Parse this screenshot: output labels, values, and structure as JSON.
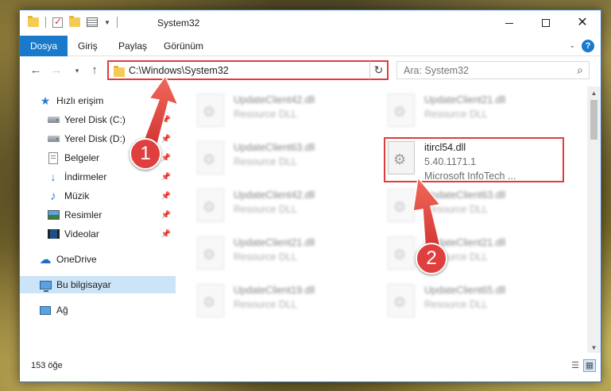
{
  "window": {
    "title": "System32",
    "minimize_symbol": "—",
    "close_symbol": "✕"
  },
  "ribbon": {
    "tabs": [
      "Dosya",
      "Giriş",
      "Paylaş",
      "Görünüm"
    ]
  },
  "address_bar": {
    "path": "C:\\Windows\\System32",
    "dropdown_symbol": "⌄",
    "refresh_symbol": "↻"
  },
  "search": {
    "placeholder": "Ara: System32"
  },
  "nav_pane": {
    "items": [
      {
        "label": "Hızlı erişim",
        "icon": "star-icon",
        "pinned": false
      },
      {
        "label": "Yerel Disk (C:)",
        "icon": "drive-icon",
        "pinned": true
      },
      {
        "label": "Yerel Disk (D:)",
        "icon": "drive-icon",
        "pinned": true
      },
      {
        "label": "Belgeler",
        "icon": "documents-icon",
        "pinned": true
      },
      {
        "label": "İndirmeler",
        "icon": "download-icon",
        "pinned": true
      },
      {
        "label": "Müzik",
        "icon": "music-icon",
        "pinned": true
      },
      {
        "label": "Resimler",
        "icon": "pictures-icon",
        "pinned": true
      },
      {
        "label": "Videolar",
        "icon": "videos-icon",
        "pinned": true
      },
      {
        "label": "OneDrive",
        "icon": "onedrive-icon",
        "pinned": false
      },
      {
        "label": "Bu bilgisayar",
        "icon": "this-pc-icon",
        "pinned": false,
        "selected": true
      },
      {
        "label": "Ağ",
        "icon": "network-icon",
        "pinned": false
      }
    ]
  },
  "files": {
    "left_column": [
      {
        "name": "UpdateClient42.dll",
        "desc": "Resource DLL"
      },
      {
        "name": "UpdateClient63.dll",
        "desc": "Resource DLL"
      },
      {
        "name": "UpdateClient42.dll",
        "desc": "Resource DLL"
      },
      {
        "name": "UpdateClient21.dll",
        "desc": "Resource DLL"
      },
      {
        "name": "UpdateClient19.dll",
        "desc": "Resource DLL"
      }
    ],
    "right_column": [
      {
        "name": "UpdateClient21.dll",
        "desc": "Resource DLL"
      },
      {
        "name": "UpdateClient63.dll",
        "desc": "Resource DLL"
      },
      {
        "name": "UpdateClient21.dll",
        "desc": "Resource DLL"
      },
      {
        "name": "UpdateClient65.dll",
        "desc": "Resource DLL"
      }
    ],
    "highlighted": {
      "name": "itircl54.dll",
      "version": "5.40.1171.1",
      "company": "Microsoft InfoTech ..."
    }
  },
  "status_bar": {
    "item_count": "153 öğe"
  },
  "annotations": {
    "badge_1": "1",
    "badge_2": "2",
    "color": "#df3f3f"
  }
}
